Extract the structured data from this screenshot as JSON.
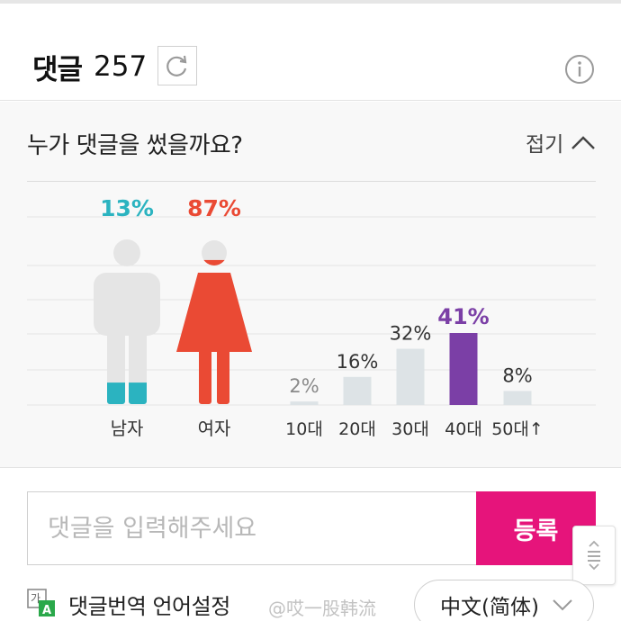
{
  "header": {
    "title": "댓글",
    "count": "257",
    "refresh_icon": "refresh-icon",
    "info_icon": "info-icon"
  },
  "panel": {
    "question": "누가 댓글을 썼을까요?",
    "collapse_label": "접기"
  },
  "colors": {
    "male": "#2bb3c0",
    "female": "#ea4a34",
    "bar_default": "#dde3e6",
    "bar_highlight": "#7b3fa6",
    "figure_gray": "#e5e5e5",
    "submit": "#e6147b"
  },
  "chart_data": [
    {
      "type": "pictogram",
      "categories": [
        "남자",
        "여자"
      ],
      "values": [
        13,
        87
      ],
      "value_labels": [
        "13%",
        "87%"
      ],
      "unit": "%"
    },
    {
      "type": "bar",
      "categories": [
        "10대",
        "20대",
        "30대",
        "40대",
        "50대↑"
      ],
      "values": [
        2,
        16,
        32,
        41,
        8
      ],
      "value_labels": [
        "2%",
        "16%",
        "32%",
        "41%",
        "8%"
      ],
      "highlight_index": 3,
      "ylim": [
        0,
        41
      ],
      "grid": true
    }
  ],
  "comment_input": {
    "placeholder": "댓글을 입력해주세요",
    "value": "",
    "submit_label": "등록"
  },
  "translate": {
    "label": "댓글번역 언어설정",
    "watermark": "@哎一股韩流",
    "selected_language": "中文(简体)"
  }
}
